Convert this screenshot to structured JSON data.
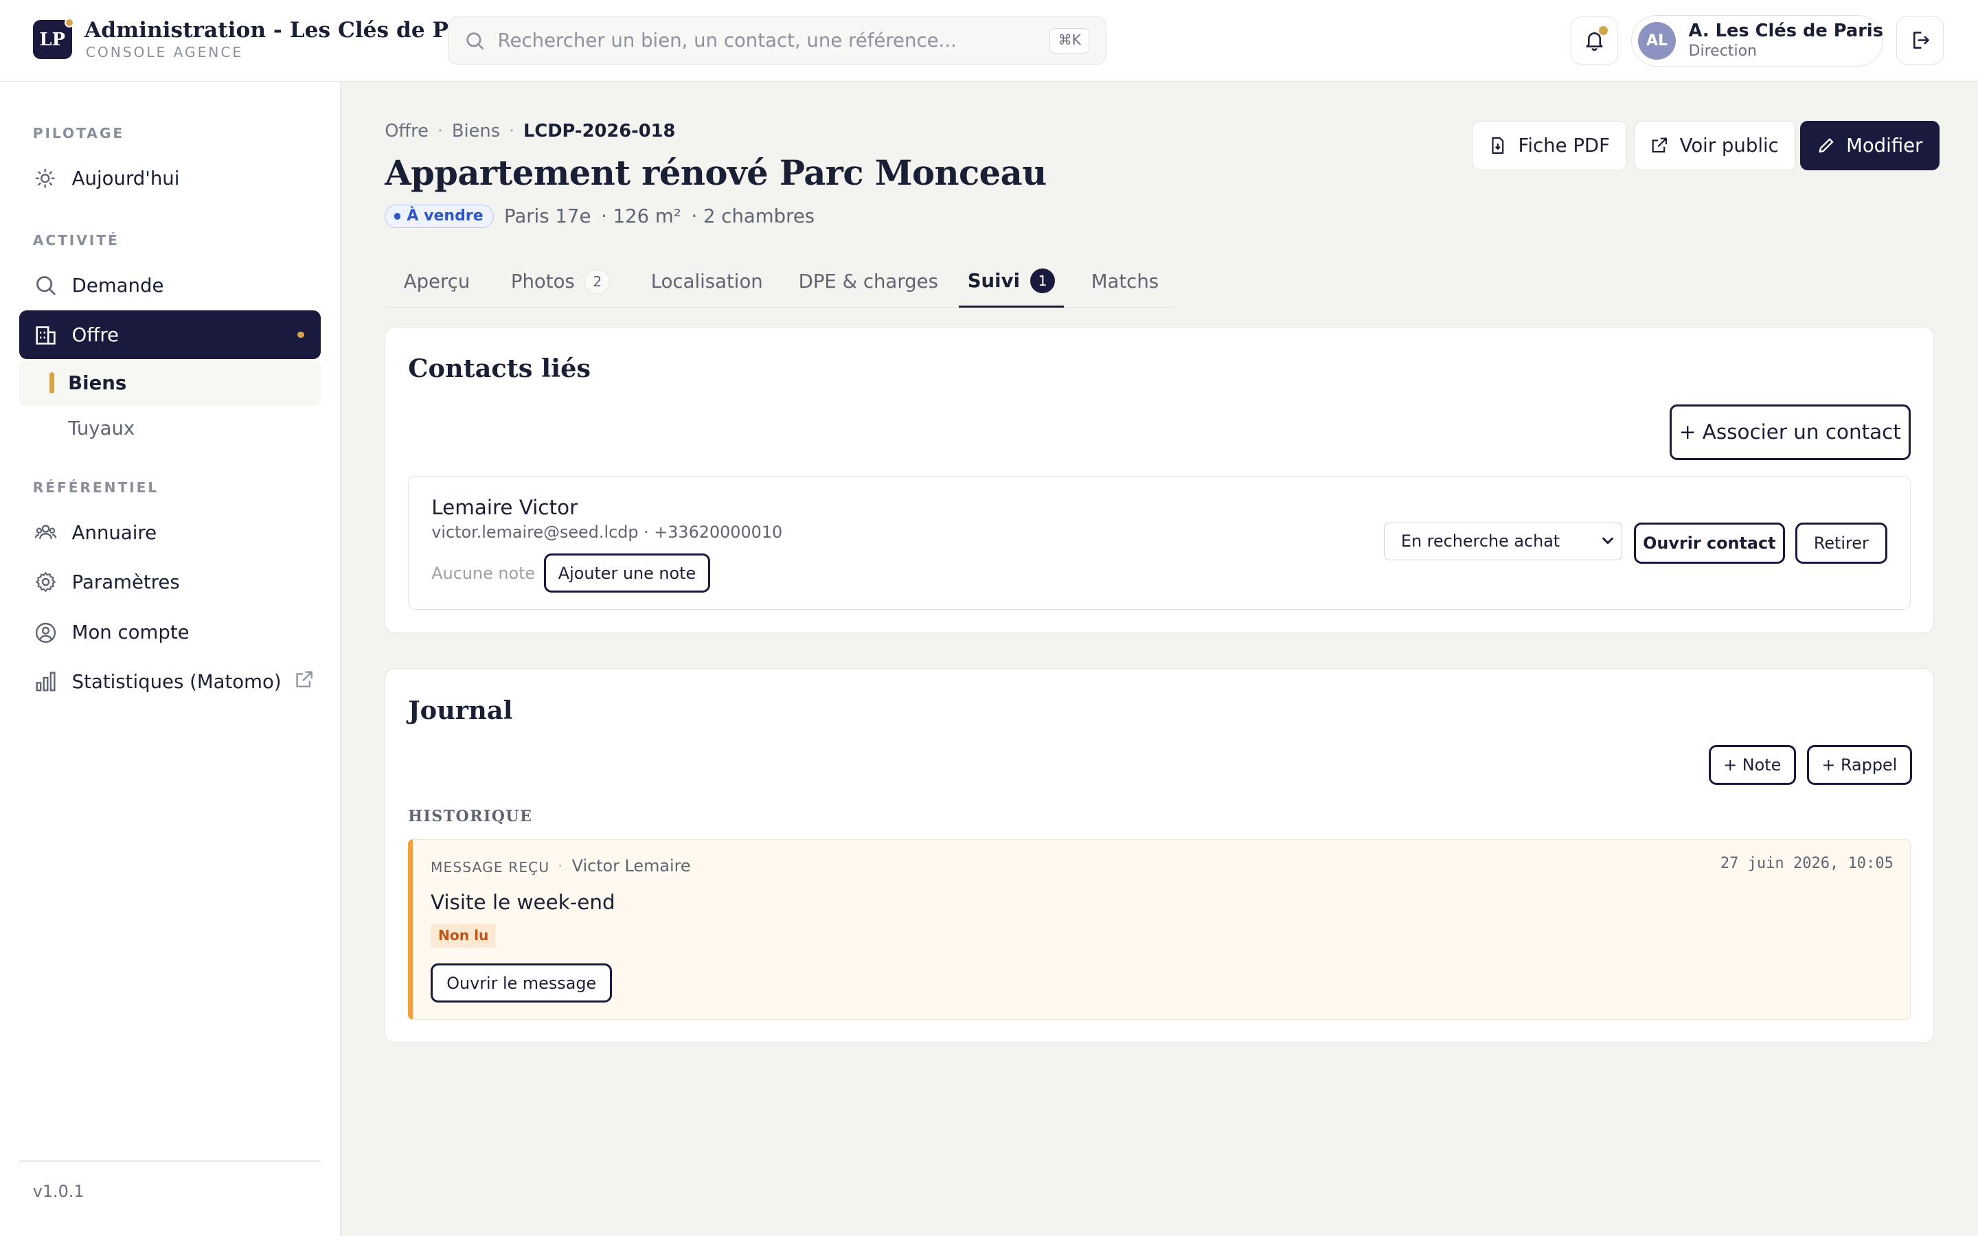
{
  "app": {
    "logo_text": "LP",
    "title": "Administration - Les Clés de Paris",
    "subtitle": "CONSOLE AGENCE"
  },
  "search": {
    "placeholder": "Rechercher un bien, un contact, une référence...",
    "shortcut": "⌘K"
  },
  "user": {
    "initials": "AL",
    "name": "A. Les Clés de Paris",
    "role": "Direction"
  },
  "sidebar": {
    "sections": {
      "pilotage": "PILOTAGE",
      "activite": "ACTIVITÉ",
      "referentiel": "RÉFÉRENTIEL"
    },
    "items": {
      "today": "Aujourd'hui",
      "demande": "Demande",
      "offre": "Offre",
      "biens": "Biens",
      "tuyaux": "Tuyaux",
      "annuaire": "Annuaire",
      "parametres": "Paramètres",
      "compte": "Mon compte",
      "stats": "Statistiques (Matomo)"
    },
    "version": "v1.0.1"
  },
  "breadcrumb": [
    "Offre",
    "Biens",
    "LCDP-2026-018"
  ],
  "property": {
    "title": "Appartement rénové Parc Monceau",
    "status": "À vendre",
    "location": "Paris 17e",
    "surface": "· 126 m²",
    "rooms": "· 2 chambres"
  },
  "actions": {
    "pdf": "Fiche PDF",
    "public": "Voir public",
    "edit": "Modifier"
  },
  "tabs": [
    {
      "label": "Aperçu"
    },
    {
      "label": "Photos",
      "count": "2"
    },
    {
      "label": "Localisation"
    },
    {
      "label": "DPE & charges"
    },
    {
      "label": "Suivi",
      "count": "1"
    },
    {
      "label": "Matchs"
    }
  ],
  "contacts": {
    "title": "Contacts liés",
    "add_button": "+ Associer un contact",
    "items": [
      {
        "name": "Lemaire Victor",
        "info": "victor.lemaire@seed.lcdp · +33620000010",
        "note_empty": "Aucune note",
        "add_note": "Ajouter une note",
        "status": "En recherche achat",
        "open": "Ouvrir contact",
        "remove": "Retirer"
      }
    ]
  },
  "journal": {
    "title": "Journal",
    "add_note": "+ Note",
    "add_reminder": "+ Rappel",
    "history_label": "HISTORIQUE",
    "entries": [
      {
        "type": "MESSAGE REÇU",
        "author": "Victor Lemaire",
        "date": "27 juin 2026, 10:05",
        "title": "Visite le week-end",
        "badge": "Non lu",
        "action": "Ouvrir le message"
      }
    ]
  },
  "colors": {
    "navy": "#1a1a3e",
    "gold": "#d4a44c",
    "status_blue": "#2e56c9",
    "journal_accent": "#f2a03d"
  }
}
